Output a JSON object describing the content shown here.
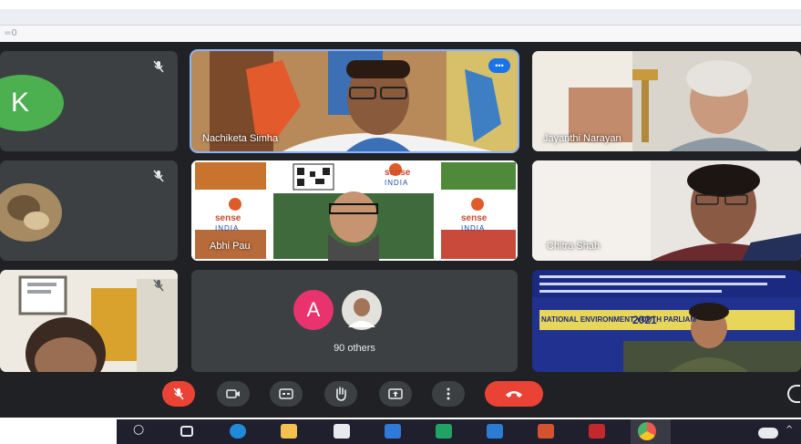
{
  "browser": {
    "bookmark_text": "=0"
  },
  "meet": {
    "tiles": [
      {
        "id": "k",
        "avatar_letter": "K",
        "muted": true
      },
      {
        "id": "nachiketa",
        "name": "Nachiketa Simha",
        "speaking": true
      },
      {
        "id": "jayanthi",
        "name": "Jayanthi Narayan"
      },
      {
        "id": "tile-4",
        "muted": true
      },
      {
        "id": "presentation",
        "name": "Abhi Pau",
        "slide_texts": [
          "sense",
          "INDIA",
          "sense",
          "INDIA",
          "sense",
          "INDIA"
        ]
      },
      {
        "id": "chitra",
        "name": "Chitra Shah"
      },
      {
        "id": "tile-7",
        "muted": true
      },
      {
        "id": "others",
        "avatar_letter": "A",
        "label": "90 others"
      },
      {
        "id": "banner",
        "banner_title": "NATIONAL ENVIRONMENT YOUTH PARLIAMENT",
        "banner_year": "2021"
      }
    ]
  },
  "controls": {
    "items": [
      "mic-off",
      "camera",
      "captions",
      "raise-hand",
      "present",
      "more-options",
      "leave-call"
    ]
  },
  "taskbar": {
    "apps": [
      "search",
      "task-view",
      "edge",
      "file-explorer",
      "store",
      "mail",
      "excel",
      "word",
      "powerpoint",
      "office",
      "chrome"
    ]
  },
  "colors": {
    "meet_background": "#202124",
    "tile_background": "#3c4043",
    "active_border": "#8ab4f8",
    "red": "#ea4335",
    "green_avatar": "#34a853",
    "pink_avatar": "#e8336f"
  }
}
